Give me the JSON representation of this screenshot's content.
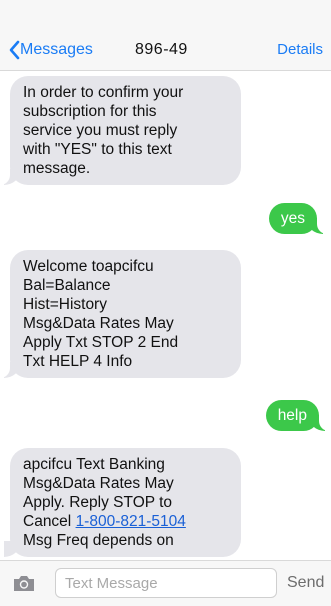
{
  "header": {
    "back_label": "Messages",
    "contact": "896-49",
    "details_label": "Details"
  },
  "messages": [
    {
      "direction": "incoming",
      "lines": [
        "In order to confirm your",
        "subscription for this",
        "service you must reply",
        "with \"YES\" to this text",
        "message."
      ]
    },
    {
      "direction": "outgoing",
      "text": "yes"
    },
    {
      "direction": "incoming",
      "lines": [
        "Welcome toapcifcu",
        "Bal=Balance",
        "Hist=History",
        "Msg&Data Rates May",
        "Apply Txt STOP 2 End",
        "Txt HELP 4 Info"
      ]
    },
    {
      "direction": "outgoing",
      "text": "help"
    },
    {
      "direction": "incoming",
      "lines": [
        "apcifcu Text Banking",
        "Msg&Data Rates May",
        "Apply. Reply STOP to",
        "Msg Freq depends on"
      ],
      "cancel_prefix": "Cancel ",
      "phone_link": "1-800-821-5104"
    }
  ],
  "composer": {
    "placeholder": "Text Message",
    "send_label": "Send"
  },
  "colors": {
    "accent": "#1a7cf5",
    "incoming_bubble": "#e5e5ea",
    "outgoing_bubble": "#3cc84a"
  },
  "icons": {
    "back": "chevron-left-icon",
    "camera": "camera-icon"
  }
}
